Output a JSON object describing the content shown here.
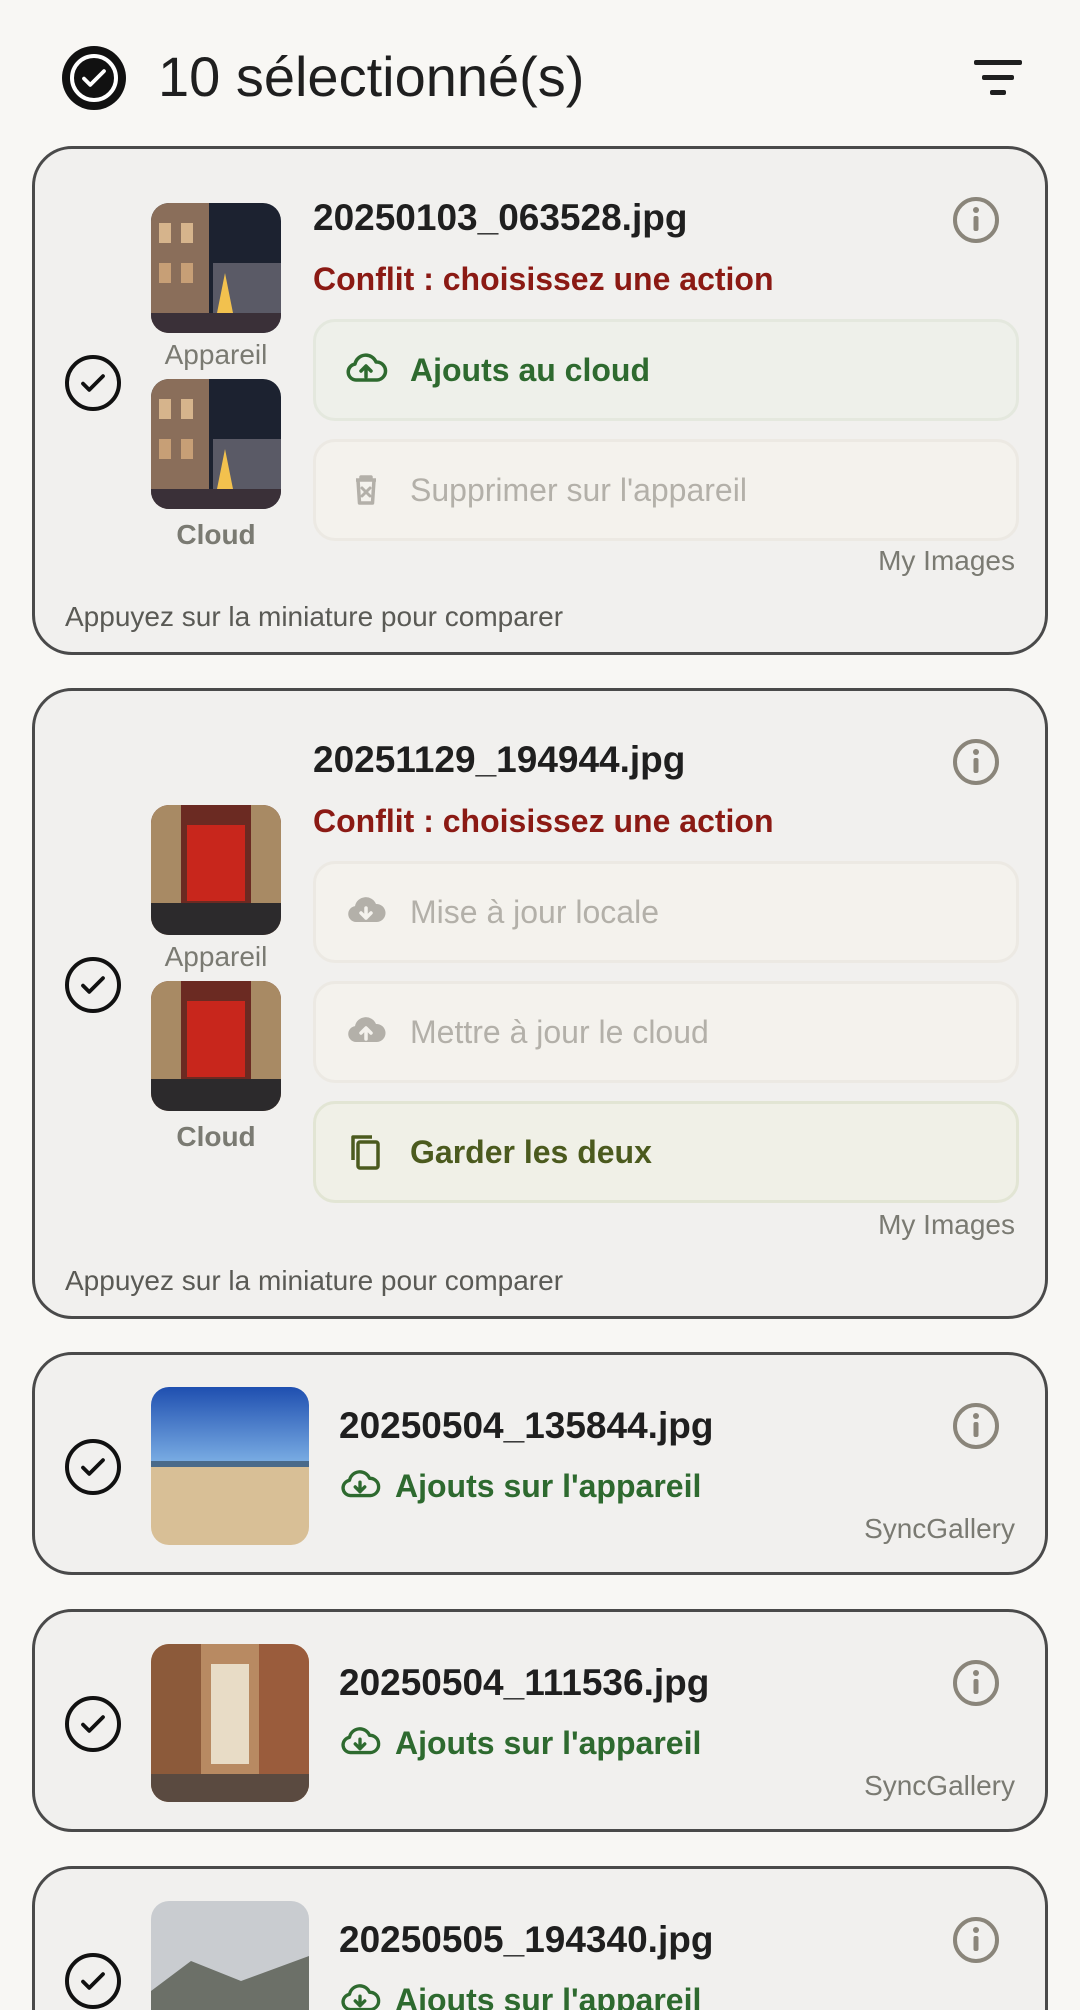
{
  "header": {
    "title": "10 sélectionné(s)"
  },
  "cards": [
    {
      "filename": "20250103_063528.jpg",
      "conflict": "Conflit : choisissez une action",
      "thumb_device_label": "Appareil",
      "thumb_cloud_label": "Cloud",
      "actions": [
        "Ajouts au cloud",
        "Supprimer sur l'appareil"
      ],
      "origin": "My Images",
      "hint": "Appuyez sur la miniature pour comparer"
    },
    {
      "filename": "20251129_194944.jpg",
      "conflict": "Conflit : choisissez une action",
      "thumb_device_label": "Appareil",
      "thumb_cloud_label": "Cloud",
      "actions": [
        "Mise à jour locale",
        "Mettre à jour le cloud",
        "Garder les deux"
      ],
      "origin": "My Images",
      "hint": "Appuyez sur la miniature pour comparer"
    },
    {
      "filename": "20250504_135844.jpg",
      "status": "Ajouts sur l'appareil",
      "origin": "SyncGallery"
    },
    {
      "filename": "20250504_111536.jpg",
      "status": "Ajouts sur l'appareil",
      "origin": "SyncGallery"
    },
    {
      "filename": "20250505_194340.jpg",
      "status": "Ajouts sur l'appareil"
    }
  ],
  "colors": {
    "conflict": "#8b1a14",
    "success": "#2e6a2f",
    "olive": "#4b5a1e",
    "disabled": "#b3b0a9",
    "border": "#4a4a4a"
  },
  "icons": [
    "select-all-check-icon",
    "filter-icon",
    "info-icon",
    "cloud-upload-icon",
    "delete-icon",
    "cloud-download-icon",
    "copy-icon",
    "check-icon"
  ]
}
